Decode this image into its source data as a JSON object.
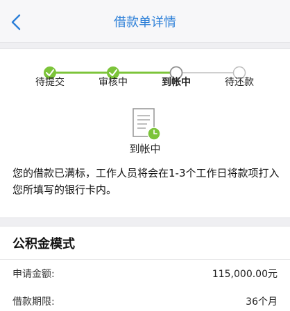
{
  "navbar": {
    "title": "借款单详情",
    "back_icon": "chevron-left-icon"
  },
  "progress": {
    "steps": [
      {
        "label": "待提交",
        "state": "done"
      },
      {
        "label": "审核中",
        "state": "done"
      },
      {
        "label": "到帐中",
        "state": "current"
      },
      {
        "label": "待还款",
        "state": "pending"
      }
    ],
    "colors": {
      "done": "#7cc43a",
      "pending": "#c8c8c8",
      "current_ring": "#9a9a9a"
    }
  },
  "status": {
    "icon": "document-clock-icon",
    "text": "到帐中",
    "message": "您的借款已满标，工作人员将会在1-3个工作日将款项打入您所填写的银行卡内。"
  },
  "details": {
    "title": "公积金模式",
    "rows": [
      {
        "label": "申请金额:",
        "value": "115,000.00元"
      },
      {
        "label": "借款期限:",
        "value": "36个月"
      }
    ]
  }
}
